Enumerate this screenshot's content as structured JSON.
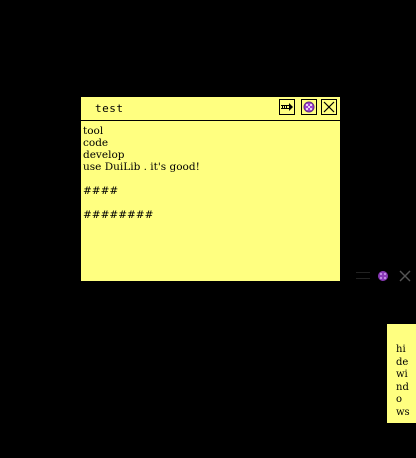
{
  "note": {
    "title": "test",
    "content": "tool\ncode\ndevelop\nuse DuiLib . it's good!\n\n####\n\n########",
    "icons": {
      "hide": "arrow-right-icon",
      "color": "purple-palette-icon",
      "close": "close-x-icon"
    }
  },
  "side_tab": {
    "label": "hidewindows"
  },
  "colors": {
    "note_background": "#ffff80",
    "desktop_background": "#000000",
    "accent_purple": "#a040d0"
  }
}
